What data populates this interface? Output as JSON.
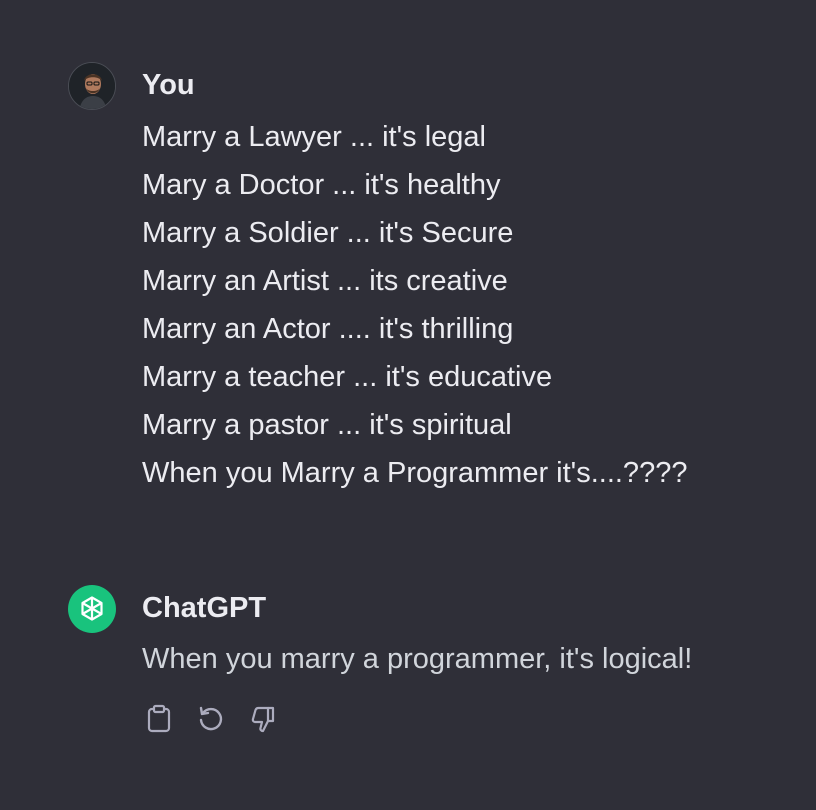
{
  "conversation": {
    "user": {
      "author": "You",
      "avatar_icon": "user-photo-avatar",
      "lines": [
        "Marry a Lawyer ... it's legal",
        "Mary a Doctor ... it's healthy",
        "Marry a Soldier ... it's Secure",
        "Marry an Artist ... its creative",
        "Marry an Actor .... it's thrilling",
        "Marry a teacher ... it's educative",
        "Marry a pastor ... it's spiritual",
        "When you Marry a Programmer it's....????"
      ]
    },
    "assistant": {
      "author": "ChatGPT",
      "avatar_icon": "openai-logo-icon",
      "text": "When you marry a programmer, it's logical!",
      "actions": [
        "clipboard-icon",
        "regenerate-icon",
        "thumbs-down-icon"
      ]
    }
  },
  "colors": {
    "background": "#2f2f38",
    "text": "#ececf1",
    "bot_text": "#d1d5db",
    "icon": "#acacbe",
    "bot_avatar": "#19c37d"
  }
}
